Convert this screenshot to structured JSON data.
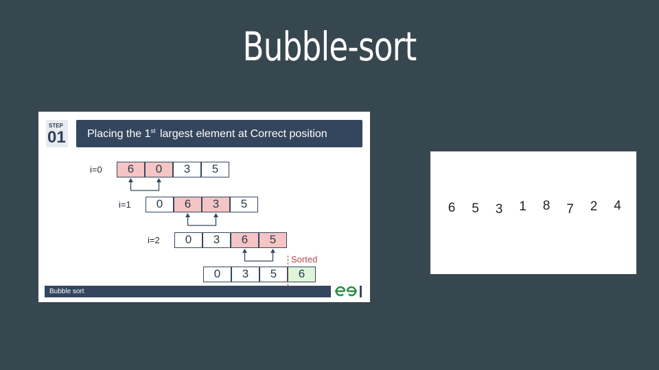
{
  "slide": {
    "title": "Bubble-sort"
  },
  "diagram": {
    "step_label": "STEP",
    "step_number": "01",
    "header_pre": "Placing the 1",
    "header_sup": "st",
    "header_post": " largest element at Correct position",
    "caption": "Bubble sort",
    "sorted_label": "Sorted",
    "rows": [
      {
        "label": "i=0",
        "cells": [
          "6",
          "0",
          "3",
          "5"
        ],
        "highlight": [
          0,
          1
        ]
      },
      {
        "label": "i=1",
        "cells": [
          "0",
          "6",
          "3",
          "5"
        ],
        "highlight": [
          1,
          2
        ]
      },
      {
        "label": "i=2",
        "cells": [
          "0",
          "3",
          "6",
          "5"
        ],
        "highlight": [
          2,
          3
        ]
      },
      {
        "label": "",
        "cells": [
          "0",
          "3",
          "5",
          "6"
        ],
        "highlight": [],
        "sorted_index": 3
      }
    ],
    "colors": {
      "header": "#34465d",
      "highlight": "#f5c4c4",
      "sorted": "#def5d9",
      "sorted_text": "#b14747",
      "logo": "#2f8d46"
    }
  },
  "array": {
    "values": [
      "6",
      "5",
      "3",
      "1",
      "8",
      "7",
      "2",
      "4"
    ]
  }
}
